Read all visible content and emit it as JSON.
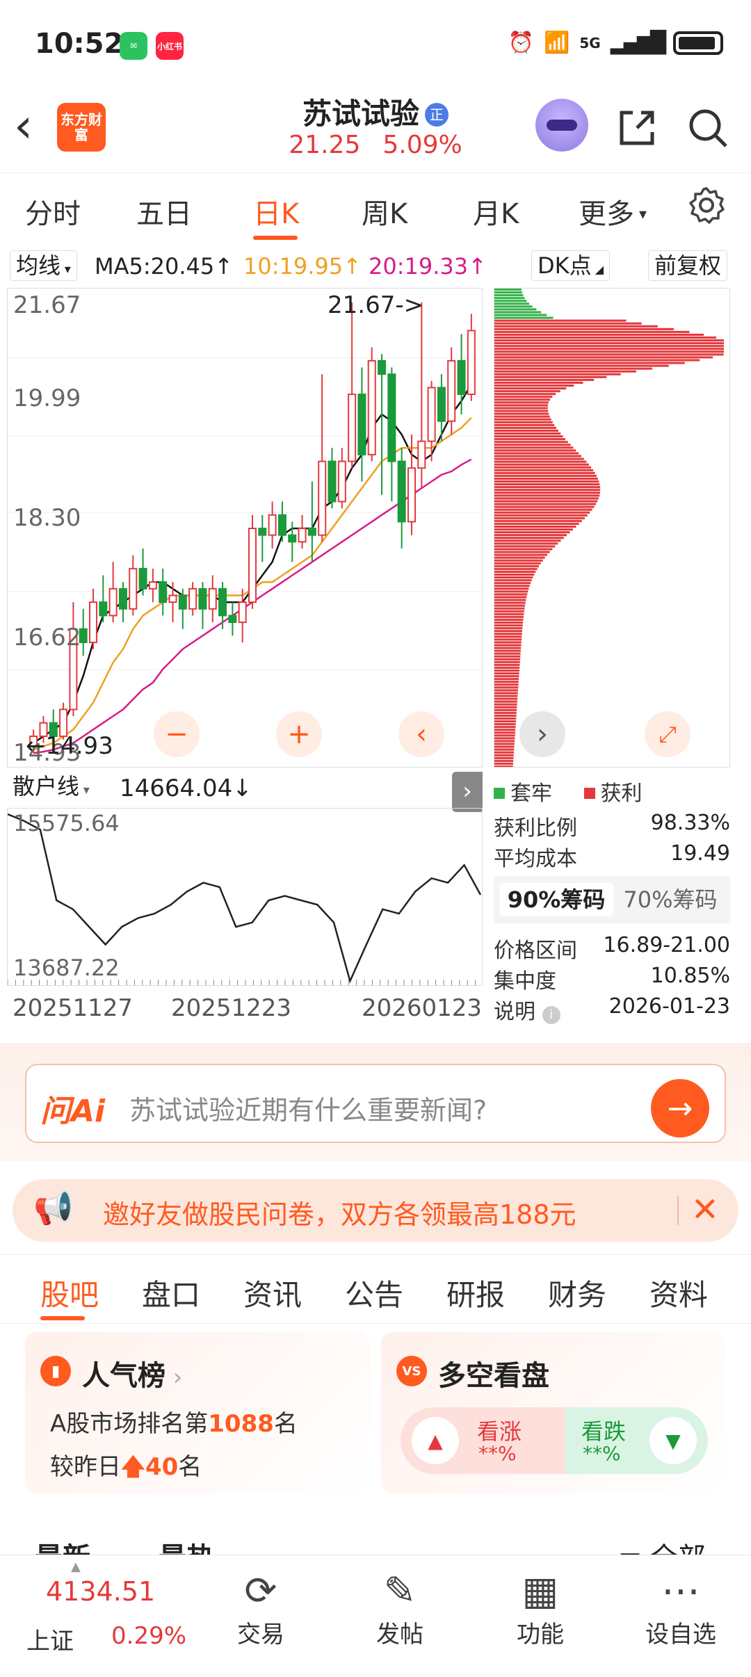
{
  "status": {
    "time": "10:52",
    "apps": [
      "WeChat",
      "小红书"
    ],
    "network": "5G"
  },
  "header": {
    "logo": "东方财富",
    "stock_name": "苏试试验",
    "badge": "正",
    "price": "21.25",
    "change_pct": "5.09%"
  },
  "period_tabs": [
    "分时",
    "五日",
    "日K",
    "周K",
    "月K",
    "更多"
  ],
  "active_period": "日K",
  "indicators": {
    "ma_type": "均线",
    "ma5": "MA5:20.45↑",
    "ma10": "10:19.95↑",
    "ma20": "20:19.33↑",
    "dk_label": "DK点",
    "adjust": "前复权"
  },
  "kchart": {
    "price_labels": [
      "21.67",
      "19.99",
      "18.30",
      "16.62",
      "14.93"
    ],
    "high_marker": "21.67->",
    "low_marker": "←14.93",
    "colors": {
      "up": "#e4393c",
      "down": "#1a9a3c",
      "ma5": "#111111",
      "ma10": "#f0a020",
      "ma20": "#d81b8a",
      "buy": "#f07070",
      "sell": "#4d9af0",
      "t": "#ffa640"
    }
  },
  "chart_data": {
    "type": "candlestick",
    "ylim": [
      14.93,
      21.67
    ],
    "candles": [
      [
        15.05,
        15.2,
        14.95,
        15.3
      ],
      [
        15.2,
        15.4,
        15.1,
        15.5
      ],
      [
        15.4,
        15.2,
        15.1,
        15.6
      ],
      [
        15.2,
        15.6,
        15.15,
        15.7
      ],
      [
        15.6,
        16.8,
        15.5,
        17.2
      ],
      [
        16.8,
        16.6,
        16.4,
        17.1
      ],
      [
        16.6,
        17.2,
        16.5,
        17.4
      ],
      [
        17.2,
        17.0,
        16.9,
        17.6
      ],
      [
        17.0,
        17.4,
        16.9,
        17.8
      ],
      [
        17.4,
        17.1,
        16.9,
        17.5
      ],
      [
        17.1,
        17.7,
        17.0,
        17.9
      ],
      [
        17.7,
        17.4,
        17.3,
        18.0
      ],
      [
        17.4,
        17.5,
        17.2,
        17.7
      ],
      [
        17.5,
        17.2,
        17.0,
        17.7
      ],
      [
        17.2,
        17.3,
        16.9,
        17.5
      ],
      [
        17.3,
        17.1,
        16.8,
        17.4
      ],
      [
        17.1,
        17.4,
        17.0,
        17.5
      ],
      [
        17.4,
        17.1,
        16.8,
        17.5
      ],
      [
        17.1,
        17.4,
        16.9,
        17.6
      ],
      [
        17.4,
        17.0,
        16.8,
        17.5
      ],
      [
        17.0,
        16.9,
        16.7,
        17.2
      ],
      [
        16.9,
        17.2,
        16.6,
        17.4
      ],
      [
        17.2,
        18.3,
        17.1,
        18.5
      ],
      [
        18.3,
        18.2,
        17.8,
        18.5
      ],
      [
        18.2,
        18.5,
        18.0,
        18.7
      ],
      [
        18.5,
        18.2,
        18.1,
        18.7
      ],
      [
        18.2,
        18.1,
        17.8,
        18.4
      ],
      [
        18.1,
        18.3,
        18.0,
        18.5
      ],
      [
        18.3,
        18.2,
        17.8,
        19.0
      ],
      [
        18.2,
        19.3,
        18.1,
        20.6
      ],
      [
        19.3,
        18.7,
        18.6,
        19.5
      ],
      [
        18.7,
        19.3,
        18.6,
        19.5
      ],
      [
        19.3,
        20.3,
        19.2,
        21.67
      ],
      [
        20.3,
        19.4,
        19.0,
        20.7
      ],
      [
        19.4,
        20.8,
        19.3,
        21.0
      ],
      [
        20.8,
        20.6,
        18.8,
        20.9
      ],
      [
        20.6,
        19.3,
        18.7,
        20.7
      ],
      [
        19.3,
        18.4,
        18.0,
        19.5
      ],
      [
        18.4,
        19.2,
        18.2,
        19.7
      ],
      [
        19.2,
        19.6,
        18.9,
        21.67
      ],
      [
        19.6,
        20.4,
        19.3,
        20.5
      ],
      [
        20.4,
        19.9,
        19.6,
        20.6
      ],
      [
        19.9,
        20.8,
        19.7,
        21.0
      ],
      [
        20.8,
        20.3,
        20.0,
        21.2
      ],
      [
        20.3,
        21.25,
        20.2,
        21.5
      ]
    ],
    "series": [
      {
        "name": "MA5",
        "values": [
          15.1,
          15.2,
          15.3,
          15.4,
          15.7,
          16.1,
          16.6,
          17.0,
          17.1,
          17.2,
          17.3,
          17.4,
          17.5,
          17.5,
          17.4,
          17.3,
          17.3,
          17.3,
          17.3,
          17.2,
          17.2,
          17.2,
          17.4,
          17.6,
          17.8,
          18.2,
          18.3,
          18.3,
          18.3,
          18.6,
          18.7,
          18.9,
          19.2,
          19.4,
          19.8,
          20.0,
          19.9,
          19.7,
          19.4,
          19.3,
          19.4,
          19.7,
          20.0,
          20.2,
          20.45
        ]
      },
      {
        "name": "MA10",
        "values": [
          15.0,
          15.05,
          15.1,
          15.2,
          15.3,
          15.5,
          15.7,
          16.0,
          16.3,
          16.5,
          16.8,
          17.0,
          17.1,
          17.2,
          17.3,
          17.3,
          17.3,
          17.3,
          17.3,
          17.3,
          17.3,
          17.3,
          17.4,
          17.5,
          17.5,
          17.6,
          17.7,
          17.8,
          17.9,
          18.1,
          18.3,
          18.5,
          18.7,
          18.9,
          19.1,
          19.3,
          19.4,
          19.5,
          19.5,
          19.5,
          19.5,
          19.6,
          19.7,
          19.8,
          19.95
        ]
      },
      {
        "name": "MA20",
        "values": [
          14.95,
          14.97,
          15.0,
          15.05,
          15.1,
          15.2,
          15.3,
          15.4,
          15.5,
          15.6,
          15.75,
          15.9,
          16.0,
          16.2,
          16.35,
          16.5,
          16.6,
          16.7,
          16.8,
          16.9,
          17.0,
          17.1,
          17.2,
          17.3,
          17.4,
          17.5,
          17.6,
          17.7,
          17.8,
          17.9,
          18.0,
          18.1,
          18.2,
          18.3,
          18.4,
          18.5,
          18.6,
          18.7,
          18.8,
          18.9,
          19.0,
          19.1,
          19.15,
          19.25,
          19.33
        ]
      }
    ]
  },
  "retail_line": {
    "label": "散户线",
    "value": "14664.04↓",
    "max": "15575.64",
    "min": "13687.22",
    "dates": [
      "20251127",
      "20251223",
      "20260123"
    ],
    "values": [
      15575.64,
      15500,
      15400,
      14600,
      14500,
      14300,
      14100,
      14300,
      14400,
      14450,
      14550,
      14700,
      14800,
      14750,
      14300,
      14350,
      14600,
      14650,
      14600,
      14550,
      14350,
      13687.22,
      14100,
      14500,
      14450,
      14700,
      14850,
      14800,
      15000,
      14664.04
    ]
  },
  "chip": {
    "legend_trapped": "套牢",
    "legend_profit": "获利",
    "profit_ratio_label": "获利比例",
    "profit_ratio": "98.33%",
    "avg_cost_label": "平均成本",
    "avg_cost": "19.49",
    "tab_90": "90%筹码",
    "tab_70": "70%筹码",
    "range_label": "价格区间",
    "range": "16.89-21.00",
    "concentration_label": "集中度",
    "concentration": "10.85%",
    "note_label": "说明",
    "date": "2026-01-23"
  },
  "ai": {
    "logo": "问Ai",
    "placeholder": "苏试试验近期有什么重要新闻?"
  },
  "promo": {
    "text": "邀好友做股民问卷，双方各领最高188元"
  },
  "content_tabs": [
    "股吧",
    "盘口",
    "资讯",
    "公告",
    "研报",
    "财务",
    "资料"
  ],
  "popularity": {
    "title": "人气榜",
    "rank_prefix": "A股市场排名第",
    "rank": "1088",
    "rank_suffix": "名",
    "change_prefix": "较昨日",
    "change": "40",
    "change_suffix": "名"
  },
  "sentiment": {
    "title": "多空看盘",
    "bull_label": "看涨",
    "bull_value": "**%",
    "bear_label": "看跌",
    "bear_value": "**%"
  },
  "feed": {
    "latest": "最新",
    "hot": "最热",
    "all": "全部"
  },
  "bottom_nav": {
    "index_value": "4134.51",
    "index_name": "上证",
    "index_change": "0.29%",
    "items": [
      "交易",
      "发帖",
      "功能",
      "设自选"
    ]
  }
}
